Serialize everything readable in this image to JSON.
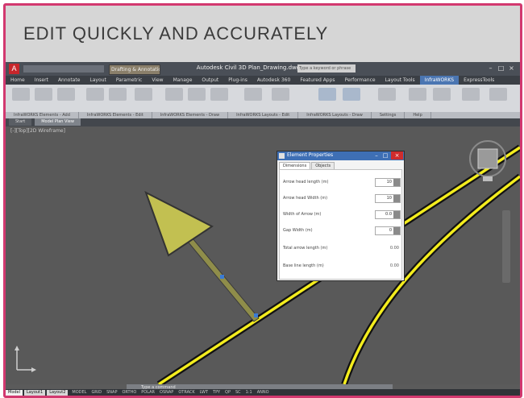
{
  "banner": {
    "title": "EDIT QUICKLY AND ACCURATELY"
  },
  "titlebar": {
    "app_logo": "A",
    "workspace": "Drafting & Annotation",
    "document_title": "Autodesk Civil 3D    Plan_Drawing.dwg",
    "search_placeholder": "Type a keyword or phrase",
    "controls": [
      "–",
      "□",
      "×"
    ]
  },
  "ribbon": {
    "tabs": [
      "Home",
      "Insert",
      "Annotate",
      "Layout",
      "Parametric",
      "View",
      "Manage",
      "Output",
      "Plug-ins",
      "Autodesk 360",
      "Featured Apps",
      "Performance",
      "Layout Tools",
      "InfraWORKS",
      "ExpressTools"
    ],
    "active_tab_index": 13,
    "panels": [
      "InfraWORKS Elements - Add",
      "InfraWORKS Elements - Edit",
      "InfraWORKS Elements - Draw",
      "InfraWORKS Layouts - Edit",
      "InfraWORKS Layouts - Draw",
      "Settings",
      "Help"
    ]
  },
  "doc_tabs": [
    "Start",
    "Model Plan View"
  ],
  "doc_active_index": 1,
  "viewport": {
    "label": "[-][Top][2D Wireframe]"
  },
  "dialog": {
    "title": "Element Properties",
    "tabs": [
      "Dimensions",
      "Objects"
    ],
    "active_tab_index": 0,
    "rows": [
      {
        "label": "Arrow head length (m)",
        "value": "10",
        "kind": "spin"
      },
      {
        "label": "Arrow head Width (m)",
        "value": "10",
        "kind": "spin"
      },
      {
        "label": "Width of Arrow (m)",
        "value": "0.0",
        "kind": "spin"
      },
      {
        "label": "Gap Width (m)",
        "value": "0",
        "kind": "spin"
      },
      {
        "label": "Total arrow length (m)",
        "value": "0.00",
        "kind": "readonly"
      },
      {
        "label": "Base line length (m)",
        "value": "0.00",
        "kind": "readonly"
      }
    ]
  },
  "command_line": {
    "prompt": "Type a command"
  },
  "status_bar": {
    "tabs": [
      "Model",
      "Layout1",
      "Layout2"
    ],
    "active_tab_index": 0,
    "items": [
      "MODEL",
      "GRID",
      "SNAP",
      "ORTHO",
      "POLAR",
      "OSNAP",
      "OTRACK",
      "LWT",
      "TPY",
      "QP",
      "SC",
      "1:1",
      "ANNO"
    ]
  },
  "colors": {
    "accent_frame": "#d2386f",
    "canvas": "#595959",
    "arrow_fill": "#c2c051",
    "road_yellow": "#f4ed1e",
    "dialog_title": "#3e6fb5",
    "close_button": "#cf2c2c"
  }
}
